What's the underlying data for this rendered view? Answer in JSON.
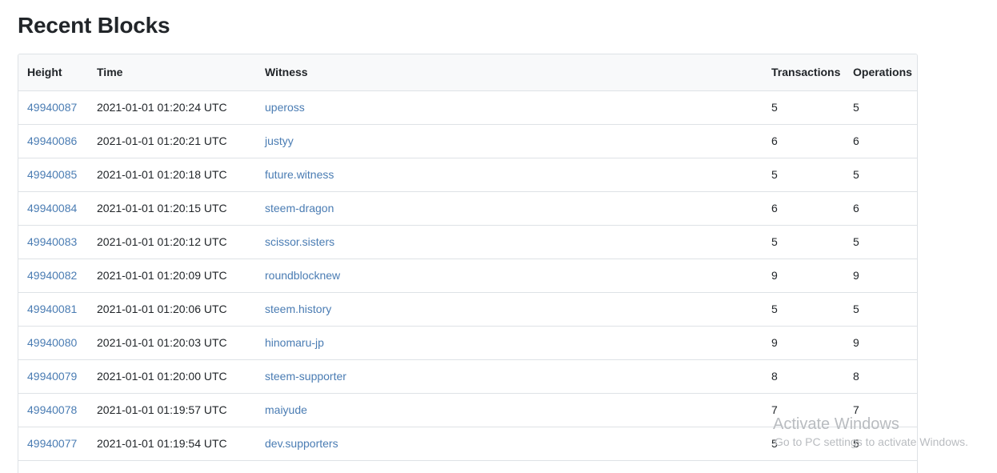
{
  "page": {
    "title": "Recent Blocks"
  },
  "table": {
    "headers": {
      "height": "Height",
      "time": "Time",
      "witness": "Witness",
      "transactions": "Transactions",
      "operations": "Operations"
    },
    "rows": [
      {
        "height": "49940087",
        "time": "2021-01-01 01:20:24 UTC",
        "witness": "upeross",
        "transactions": "5",
        "operations": "5"
      },
      {
        "height": "49940086",
        "time": "2021-01-01 01:20:21 UTC",
        "witness": "justyy",
        "transactions": "6",
        "operations": "6"
      },
      {
        "height": "49940085",
        "time": "2021-01-01 01:20:18 UTC",
        "witness": "future.witness",
        "transactions": "5",
        "operations": "5"
      },
      {
        "height": "49940084",
        "time": "2021-01-01 01:20:15 UTC",
        "witness": "steem-dragon",
        "transactions": "6",
        "operations": "6"
      },
      {
        "height": "49940083",
        "time": "2021-01-01 01:20:12 UTC",
        "witness": "scissor.sisters",
        "transactions": "5",
        "operations": "5"
      },
      {
        "height": "49940082",
        "time": "2021-01-01 01:20:09 UTC",
        "witness": "roundblocknew",
        "transactions": "9",
        "operations": "9"
      },
      {
        "height": "49940081",
        "time": "2021-01-01 01:20:06 UTC",
        "witness": "steem.history",
        "transactions": "5",
        "operations": "5"
      },
      {
        "height": "49940080",
        "time": "2021-01-01 01:20:03 UTC",
        "witness": "hinomaru-jp",
        "transactions": "9",
        "operations": "9"
      },
      {
        "height": "49940079",
        "time": "2021-01-01 01:20:00 UTC",
        "witness": "steem-supporter",
        "transactions": "8",
        "operations": "8"
      },
      {
        "height": "49940078",
        "time": "2021-01-01 01:19:57 UTC",
        "witness": "maiyude",
        "transactions": "7",
        "operations": "7"
      },
      {
        "height": "49940077",
        "time": "2021-01-01 01:19:54 UTC",
        "witness": "dev.supporters",
        "transactions": "5",
        "operations": "5"
      }
    ]
  },
  "watermark": {
    "title": "Activate Windows",
    "subtitle": "Go to PC settings to activate Windows."
  },
  "colors": {
    "link": "#4a7cb3",
    "header_bg": "#f8f9fa",
    "border": "#dee2e6",
    "text": "#212529",
    "watermark": "#b9bcc0"
  }
}
